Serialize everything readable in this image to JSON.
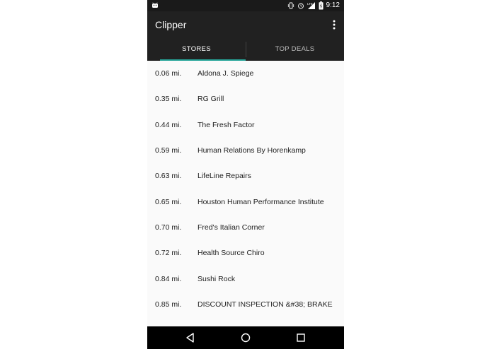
{
  "status_bar": {
    "time": "9:12",
    "network": "LTE",
    "icons": [
      "android-icon",
      "vibrate-icon",
      "alarm-icon",
      "signal-icon",
      "battery-icon"
    ]
  },
  "app_bar": {
    "title": "Clipper",
    "overflow_icon": "more-vert-icon"
  },
  "tabs": [
    {
      "label": "STORES",
      "active": true
    },
    {
      "label": "TOP DEALS",
      "active": false
    }
  ],
  "stores": [
    {
      "distance": "0.06 mi.",
      "name": "Aldona J. Spiege"
    },
    {
      "distance": "0.35 mi.",
      "name": "RG Grill"
    },
    {
      "distance": "0.44 mi.",
      "name": "The Fresh Factor"
    },
    {
      "distance": "0.59 mi.",
      "name": "Human Relations By Horenkamp"
    },
    {
      "distance": "0.63 mi.",
      "name": "LifeLine Repairs"
    },
    {
      "distance": "0.65 mi.",
      "name": "Houston Human Performance Institute"
    },
    {
      "distance": "0.70 mi.",
      "name": "Fred's Italian Corner"
    },
    {
      "distance": "0.72 mi.",
      "name": "Health Source Chiro"
    },
    {
      "distance": "0.84 mi.",
      "name": "Sushi Rock"
    },
    {
      "distance": "0.85 mi.",
      "name": "DISCOUNT INSPECTION &#38; BRAKE"
    }
  ],
  "nav_bar": {
    "buttons": [
      "back-icon",
      "home-icon",
      "recents-icon"
    ]
  },
  "colors": {
    "app_bar": "#212121",
    "tab_indicator": "#26a69a",
    "list_background": "#fafafa"
  }
}
